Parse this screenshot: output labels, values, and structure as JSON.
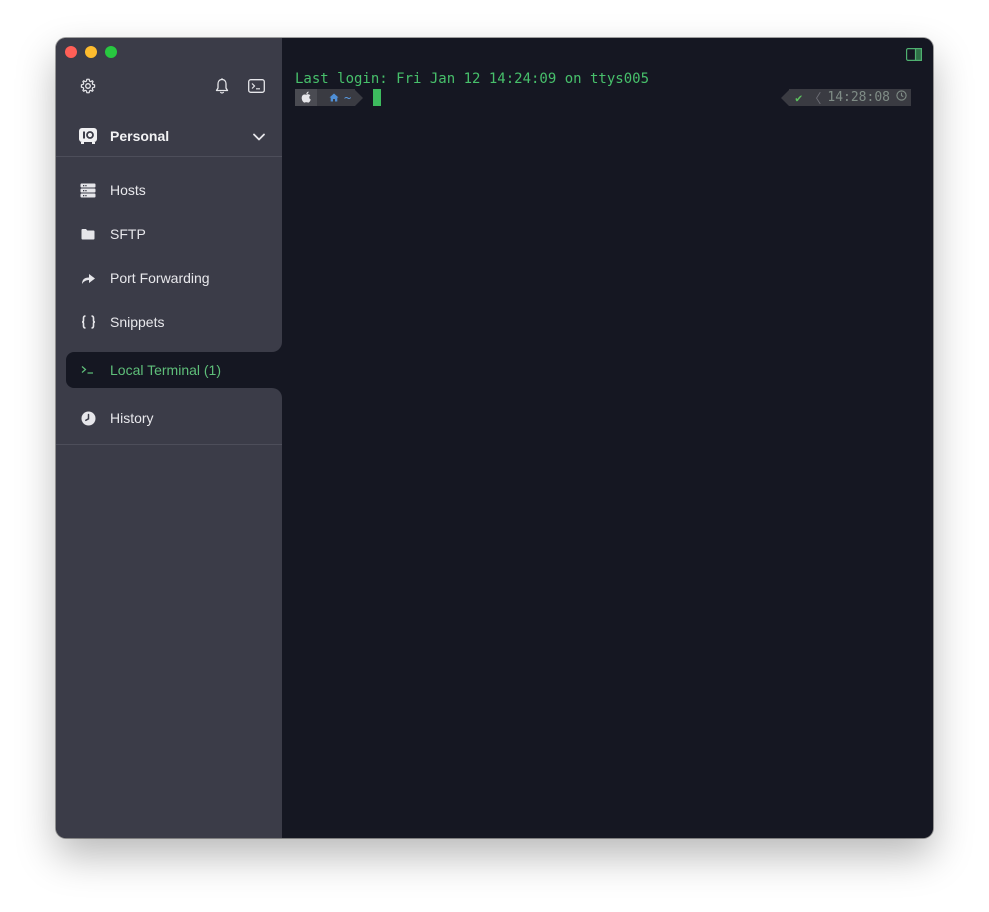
{
  "window": {
    "controls": [
      "close",
      "minimize",
      "maximize"
    ]
  },
  "sidebar": {
    "top_icons": [
      {
        "name": "gear-icon"
      },
      {
        "name": "bell-icon"
      },
      {
        "name": "terminal-icon"
      }
    ],
    "vault": {
      "label": "Personal",
      "icon": "vault-icon"
    },
    "items": [
      {
        "label": "Hosts",
        "icon": "hosts-icon"
      },
      {
        "label": "SFTP",
        "icon": "folder-icon"
      },
      {
        "label": "Port Forwarding",
        "icon": "port-forward-icon"
      },
      {
        "label": "Snippets",
        "icon": "braces-icon"
      },
      {
        "label": "Local Terminal (1)",
        "icon": "prompt-icon",
        "active": true
      },
      {
        "label": "History",
        "icon": "clock-icon"
      }
    ]
  },
  "terminal": {
    "login_line": "Last login: Fri Jan 12 14:24:09 on ttys005",
    "prompt": {
      "os_icon": "apple-icon",
      "dir_icon": "home-icon",
      "dir": "~"
    },
    "right_prompt": {
      "status": "✔",
      "time": "14:28:08",
      "clock_icon": "clock-icon"
    }
  },
  "colors": {
    "sidebar_bg": "#3b3c48",
    "terminal_bg": "#151722",
    "accent_green": "#47c06b",
    "dir_blue": "#4f8fd6"
  }
}
